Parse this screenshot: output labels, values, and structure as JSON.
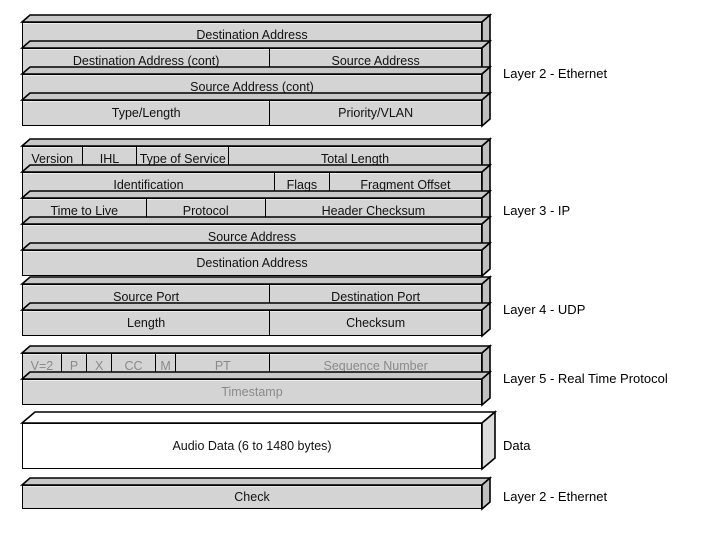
{
  "diagram": {
    "title": "Protocol stack encapsulation of an audio packet",
    "colors": {
      "fill": "#d4d4d4",
      "fill_white": "#ffffff",
      "side_face": "#c0c0c0",
      "top_face": "#c8c8c8",
      "outline": "#000000",
      "text": "#111111",
      "text_muted": "#8a8a8a"
    }
  },
  "stacks": [
    {
      "id": "ethernet-header",
      "caption": "Layer 2 - Ethernet",
      "rows": [
        {
          "fields": [
            {
              "label": "Destination Address",
              "span": 100
            }
          ]
        },
        {
          "fields": [
            {
              "label": "Destination Address (cont)",
              "span": 54
            },
            {
              "label": "Source Address",
              "span": 46
            }
          ]
        },
        {
          "fields": [
            {
              "label": "Source Address (cont)",
              "span": 100
            }
          ]
        },
        {
          "fields": [
            {
              "label": "Type/Length",
              "span": 54
            },
            {
              "label": "Priority/VLAN",
              "span": 46
            }
          ]
        }
      ]
    },
    {
      "id": "ip-header",
      "caption": "Layer 3 - IP",
      "rows": [
        {
          "fields": [
            {
              "label": "Version",
              "span": 13
            },
            {
              "label": "IHL",
              "span": 12
            },
            {
              "label": "Type of Service",
              "span": 20
            },
            {
              "label": "Total Length",
              "span": 55
            }
          ]
        },
        {
          "fields": [
            {
              "label": "Identification",
              "span": 55
            },
            {
              "label": "Flags",
              "span": 12
            },
            {
              "label": "Fragment Offset",
              "span": 33
            }
          ]
        },
        {
          "fields": [
            {
              "label": "Time to Live",
              "span": 27
            },
            {
              "label": "Protocol",
              "span": 26
            },
            {
              "label": "Header Checksum",
              "span": 47
            }
          ]
        },
        {
          "fields": [
            {
              "label": "Source Address",
              "span": 100
            }
          ]
        },
        {
          "fields": [
            {
              "label": "Destination Address",
              "span": 100
            }
          ]
        }
      ]
    },
    {
      "id": "udp-header",
      "caption": "Layer 4 - UDP",
      "rows": [
        {
          "fields": [
            {
              "label": "Source Port",
              "span": 54
            },
            {
              "label": "Destination Port",
              "span": 46
            }
          ]
        },
        {
          "fields": [
            {
              "label": "Length",
              "span": 54
            },
            {
              "label": "Checksum",
              "span": 46
            }
          ]
        }
      ]
    },
    {
      "id": "rtp-header",
      "caption": "Layer 5 - Real Time Protocol",
      "muted": true,
      "rows": [
        {
          "fields": [
            {
              "label": "V=2",
              "span": 8.5
            },
            {
              "label": "P",
              "span": 5.5
            },
            {
              "label": "X",
              "span": 5.5
            },
            {
              "label": "CC",
              "span": 9.5
            },
            {
              "label": "M",
              "span": 4.5
            },
            {
              "label": "PT",
              "span": 20.5
            },
            {
              "label": "Sequence Number",
              "span": 46
            }
          ]
        },
        {
          "fields": [
            {
              "label": "Timestamp",
              "span": 100
            }
          ]
        }
      ]
    },
    {
      "id": "payload",
      "caption": "Data",
      "white": true,
      "rows": [
        {
          "fields": [
            {
              "label": "Audio Data (6 to 1480 bytes)",
              "span": 100
            }
          ]
        }
      ]
    },
    {
      "id": "ethernet-trailer",
      "caption": "Layer 2 - Ethernet",
      "rows": [
        {
          "fields": [
            {
              "label": "Check",
              "span": 100
            }
          ]
        }
      ]
    }
  ]
}
